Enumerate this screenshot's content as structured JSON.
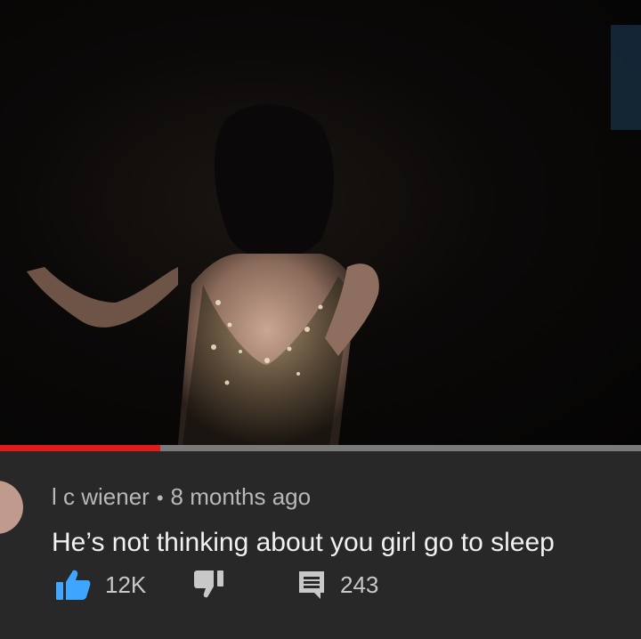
{
  "player": {
    "progress_fraction": 0.25,
    "progress_color": "#e21a1a",
    "track_color": "#7a7a7a"
  },
  "comment": {
    "author": "l c wiener",
    "separator": "•",
    "timestamp": "8 months ago",
    "text": "He’s not thinking about you girl go to sleep",
    "likes": "12K",
    "replies": "243",
    "like_icon_color": "#3ea6ff"
  },
  "icons": {
    "like": "thumbs-up-icon",
    "dislike": "thumbs-down-icon",
    "reply": "comment-icon"
  }
}
